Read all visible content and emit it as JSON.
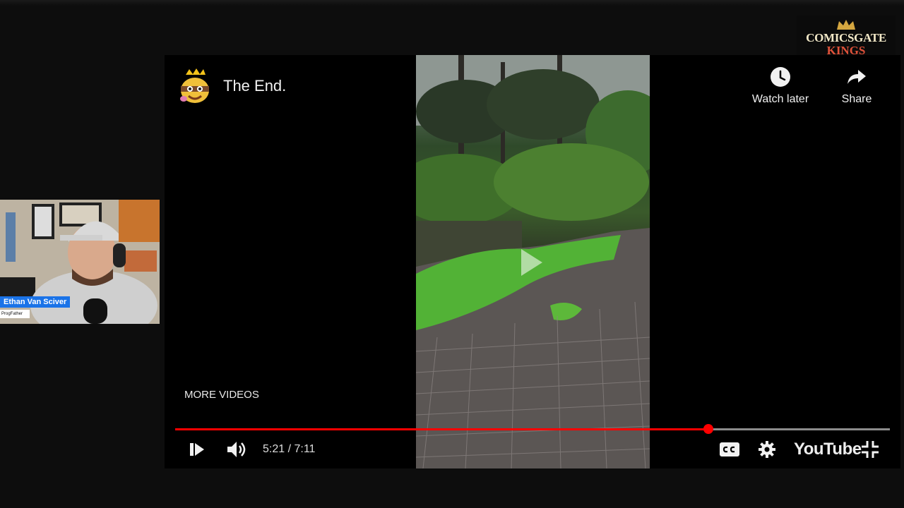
{
  "brand": {
    "line1": "COMICSGATE",
    "line2": "KINGS"
  },
  "webcam": {
    "name": "Ethan Van Sciver",
    "subtitle": "ProgFather"
  },
  "player": {
    "title": "The End.",
    "watch_later_label": "Watch later",
    "share_label": "Share",
    "more_videos_label": "MORE VIDEOS",
    "time_display": "5:21 / 7:11",
    "progress_fraction": 0.746,
    "logo_text": "YouTube",
    "accent": "#ff0000"
  }
}
